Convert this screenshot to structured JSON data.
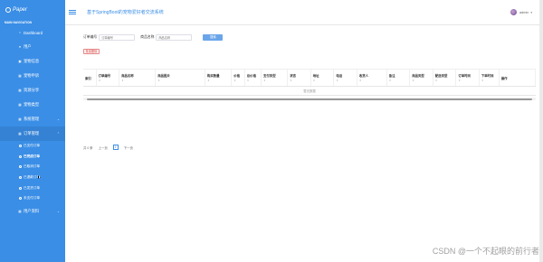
{
  "sidebar": {
    "brand": "Paper",
    "nav_title": "MAIN NAVIGATION",
    "items": [
      {
        "label": "Dashboard",
        "icon": "circle-icon"
      },
      {
        "label": "用户",
        "icon": "user-icon"
      },
      {
        "label": "宠物信息",
        "icon": "square-icon"
      },
      {
        "label": "宠物申诉",
        "icon": "grid-icon"
      },
      {
        "label": "资源分享",
        "icon": "grid-icon"
      },
      {
        "label": "宠物类型",
        "icon": "grid-icon"
      },
      {
        "label": "系统管理",
        "icon": "grid-icon"
      },
      {
        "label": "订单管理",
        "icon": "grid-icon"
      }
    ],
    "order_sub": [
      {
        "label": "已支付订单"
      },
      {
        "label": "已完成订单"
      },
      {
        "label": "已取消订单"
      },
      {
        "label": "已退款订单"
      },
      {
        "label": "已发货订单"
      },
      {
        "label": "未支付订单"
      }
    ],
    "last_item": {
      "label": "用户资料",
      "icon": "grid-icon"
    }
  },
  "header": {
    "title": "基于SpringBoot的宠物爱好者交流系统",
    "user": "admin"
  },
  "filters": {
    "order_no_label": "订单编号",
    "order_no_placeholder": "订单编号",
    "product_name_label": "商品名称",
    "product_name_placeholder": "商品名称",
    "search_button": "搜索"
  },
  "delete_button": "批量删除",
  "table": {
    "columns": [
      "索引",
      "订单编号",
      "商品名称",
      "商品图片",
      "购买数量",
      "价格",
      "总价格",
      "支付类型",
      "状态",
      "地址",
      "电话",
      "收货人",
      "备注",
      "商品类型",
      "配送类型",
      "订单时间",
      "下单时间",
      "操作"
    ],
    "empty_text": "暂无数据"
  },
  "pagination": {
    "total": "共 0 条",
    "prev": "上一页",
    "page": "1",
    "next": "下一页"
  },
  "watermark": "CSDN @一个不起眼的前行者"
}
